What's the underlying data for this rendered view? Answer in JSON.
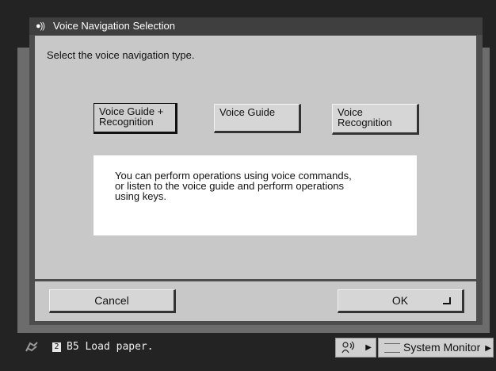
{
  "dialog": {
    "title": "Voice Navigation Selection",
    "title_icon": "●))",
    "instruction": "Select the voice navigation type."
  },
  "options": [
    {
      "line1": "Voice Guide +",
      "line2": "Recognition",
      "selected": true
    },
    {
      "line1": "Voice Guide",
      "line2": "",
      "selected": false
    },
    {
      "line1": "Voice",
      "line2": "Recognition",
      "selected": false
    }
  ],
  "info": {
    "line1": "You can perform operations using voice commands,",
    "line2": "or  listen to the voice guide and perform operations",
    "line3": "using keys."
  },
  "footer": {
    "cancel_label": "Cancel",
    "ok_label": "OK"
  },
  "status": {
    "paper_number": "2",
    "message": "B5 Load paper.",
    "voice_icon": "voice-sound-icon",
    "system_monitor_label": "System Monitor"
  }
}
